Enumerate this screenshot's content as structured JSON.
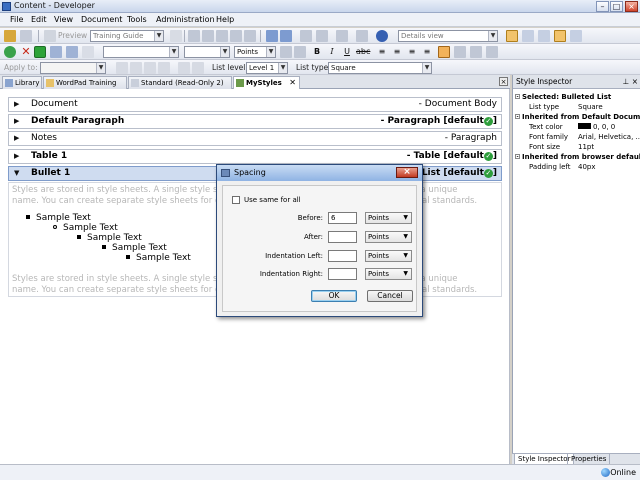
{
  "app": {
    "title": "Content - Developer"
  },
  "menu": [
    "File",
    "Edit",
    "View",
    "Document",
    "Tools",
    "Administration",
    "Help"
  ],
  "toolbar1": {
    "preview_label": "Preview",
    "template_combo": "Training Guide",
    "view_combo": "Details view"
  },
  "toolbar2": {
    "size_unit": "Points"
  },
  "toolbar3": {
    "apply_to_label": "Apply to:",
    "list_level_label": "List level:",
    "list_level_value": "Level 1",
    "list_type_label": "List type:",
    "list_type_value": "Square"
  },
  "tabs": [
    {
      "label": "Library",
      "active": false
    },
    {
      "label": "WordPad Training",
      "active": false
    },
    {
      "label": "Standard (Read-Only 2)",
      "active": false
    },
    {
      "label": "MyStyles",
      "active": true
    }
  ],
  "styles": [
    {
      "name": "Document",
      "type": "- Document Body",
      "bold": false,
      "checked": false
    },
    {
      "name": "Default Paragraph",
      "type": "- Paragraph [default",
      "bold": true,
      "checked": true
    },
    {
      "name": "Notes",
      "type": "- Paragraph",
      "bold": false,
      "checked": false
    },
    {
      "name": "Table 1",
      "type": "- Table [default",
      "bold": true,
      "checked": true
    },
    {
      "name": "Bullet 1",
      "type": "List [default",
      "bold": true,
      "checked": true
    }
  ],
  "preview": {
    "line1a": "Styles are stored in style sheets. A single style she",
    "line1b": "ed by a unique",
    "line2a": "name. You can create separate style sheets for dif",
    "line2b": "al standards.",
    "sample_items": [
      "Sample Text",
      "Sample Text",
      "Sample Text",
      "Sample Text",
      "Sample Text"
    ]
  },
  "style_inspector": {
    "title": "Style Inspector",
    "sections": [
      {
        "header": "Selected: Bulleted List",
        "rows": [
          {
            "k": "List type",
            "v": "Square"
          }
        ]
      },
      {
        "header": "Inherited from Default Documen",
        "rows": [
          {
            "k": "Text color",
            "v": "0, 0, 0",
            "swatch": "#000000"
          },
          {
            "k": "Font family",
            "v": "Arial, Helvetica, ..."
          },
          {
            "k": "Font size",
            "v": "11pt"
          }
        ]
      },
      {
        "header": "Inherited from browser defaults",
        "rows": [
          {
            "k": "Padding left",
            "v": "40px"
          }
        ]
      }
    ],
    "tabs": [
      "Style Inspector",
      "Properties"
    ]
  },
  "status": {
    "online": "Online"
  },
  "dialog": {
    "title": "Spacing",
    "use_same_label": "Use same for all",
    "fields": [
      {
        "label": "Before:",
        "value": "6",
        "unit": "Points"
      },
      {
        "label": "After:",
        "value": "",
        "unit": "Points"
      },
      {
        "label": "Indentation Left:",
        "value": "",
        "unit": "Points"
      },
      {
        "label": "Indentation Right:",
        "value": "",
        "unit": "Points"
      }
    ],
    "ok_label": "OK",
    "cancel_label": "Cancel"
  }
}
